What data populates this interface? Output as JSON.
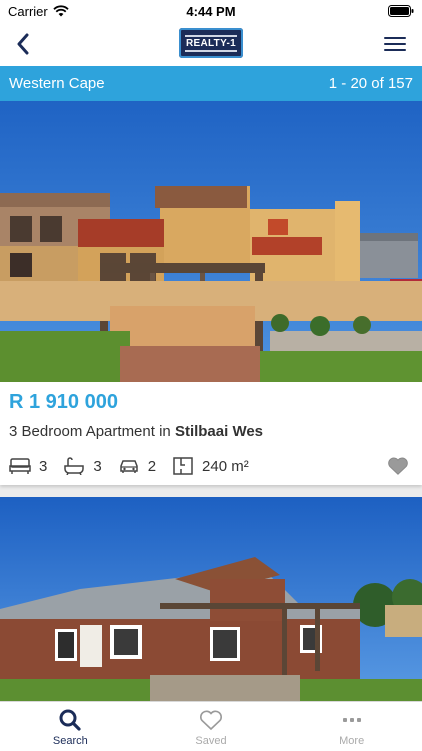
{
  "status_bar": {
    "carrier": "Carrier",
    "time": "4:44 PM"
  },
  "nav": {
    "logo_text": "REALTY-1"
  },
  "subheader": {
    "region": "Western Cape",
    "result_range": "1 - 20 of 157"
  },
  "listings": [
    {
      "price": "R 1 910 000",
      "title_prefix": "3 Bedroom Apartment in ",
      "location": "Stilbaai Wes",
      "bedrooms": "3",
      "bathrooms": "3",
      "garages": "2",
      "floor_size": "240 m²"
    }
  ],
  "tabs": [
    {
      "label": "Search",
      "icon": "search-icon",
      "active": true
    },
    {
      "label": "Saved",
      "icon": "heart-icon",
      "active": false
    },
    {
      "label": "More",
      "icon": "more-icon",
      "active": false
    }
  ],
  "colors": {
    "accent": "#2ea3dc",
    "brand_dark": "#1b2c58"
  }
}
